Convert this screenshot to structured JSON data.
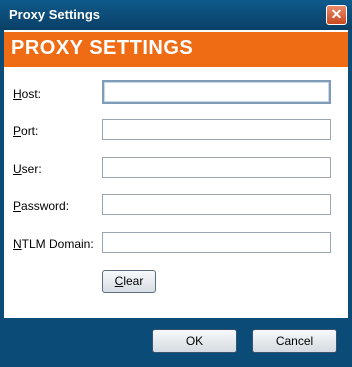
{
  "window": {
    "title": "Proxy Settings",
    "close_glyph": "✕"
  },
  "banner": {
    "text": "PROXY SETTINGS"
  },
  "fields": [
    {
      "label_u": "H",
      "label_rest": "ost:",
      "value": ""
    },
    {
      "label_u": "P",
      "label_rest": "ort:",
      "value": ""
    },
    {
      "label_u": "U",
      "label_rest": "ser:",
      "value": ""
    },
    {
      "label_u": "P",
      "label_rest": "assword:",
      "value": ""
    },
    {
      "label_u": "N",
      "label_rest": "TLM Domain:",
      "value": ""
    }
  ],
  "clear_button": {
    "label_u": "C",
    "label_rest": "lear"
  },
  "footer": {
    "ok_label": "OK",
    "cancel_label": "Cancel"
  },
  "colors": {
    "accent": "#ef6c14",
    "frame": "#0b4b77"
  }
}
